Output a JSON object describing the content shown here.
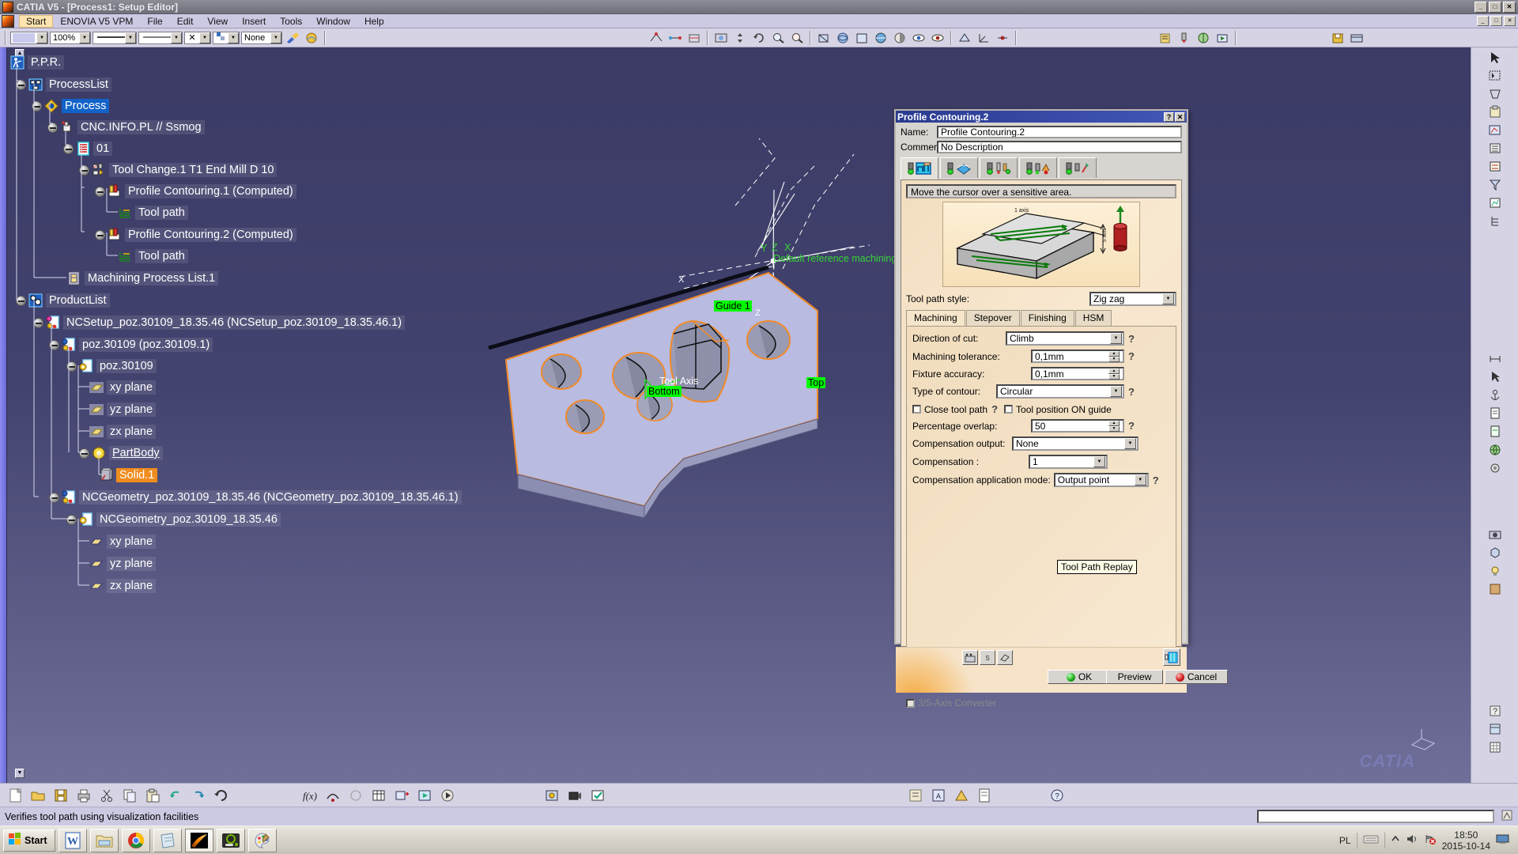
{
  "window": {
    "title": "CATIA V5 - [Process1: Setup Editor]",
    "buttons": [
      "_",
      "□",
      "✕"
    ],
    "doc_buttons": [
      "_",
      "□",
      "✕"
    ]
  },
  "menubar": {
    "items": [
      "Start",
      "ENOVIA V5 VPM",
      "File",
      "Edit",
      "View",
      "Insert",
      "Tools",
      "Window",
      "Help"
    ],
    "active": "Start"
  },
  "toolbar": {
    "zoom_value": "100%",
    "none_value": "None",
    "line_value": "",
    "weight_value": "",
    "x_value": "",
    "layer_value": ""
  },
  "tree": {
    "items": [
      {
        "label": "P.P.R.",
        "indent": 0,
        "icon": "ppr-icon",
        "state": "normal"
      },
      {
        "label": "ProcessList",
        "indent": 1,
        "icon": "processlist-icon",
        "state": "normal"
      },
      {
        "label": "Process",
        "indent": 2,
        "icon": "process-icon",
        "state": "selected"
      },
      {
        "label": "CNC.INFO.PL  // Ssmog",
        "indent": 3,
        "icon": "machine-icon",
        "state": "normal"
      },
      {
        "label": "01",
        "indent": 4,
        "icon": "program-icon",
        "state": "normal"
      },
      {
        "label": "Tool Change.1  T1 End Mill D 10",
        "indent": 5,
        "icon": "toolchange-icon",
        "state": "normal"
      },
      {
        "label": "Profile Contouring.1 (Computed)",
        "indent": 5,
        "icon": "contouring-icon",
        "state": "normal"
      },
      {
        "label": "Tool path",
        "indent": 6,
        "icon": "toolpath-icon",
        "state": "normal"
      },
      {
        "label": "Profile Contouring.2 (Computed)",
        "indent": 5,
        "icon": "contouring-icon",
        "state": "normal"
      },
      {
        "label": "Tool path",
        "indent": 6,
        "icon": "toolpath-icon",
        "state": "normal"
      },
      {
        "label": "Machining Process List.1",
        "indent": 4,
        "icon": "machproclist-icon",
        "state": "normal"
      },
      {
        "label": "ProductList",
        "indent": 1,
        "icon": "productlist-icon",
        "state": "normal"
      },
      {
        "label": "NCSetup_poz.30109_18.35.46 (NCSetup_poz.30109_18.35.46.1)",
        "indent": 2,
        "icon": "ncsetup-icon",
        "state": "normal"
      },
      {
        "label": "poz.30109 (poz.30109.1)",
        "indent": 3,
        "icon": "part-icon",
        "state": "normal"
      },
      {
        "label": "poz.30109",
        "indent": 4,
        "icon": "partdoc-icon",
        "state": "normal"
      },
      {
        "label": "xy plane",
        "indent": 5,
        "icon": "plane-icon",
        "state": "normal"
      },
      {
        "label": "yz plane",
        "indent": 5,
        "icon": "plane-icon",
        "state": "normal"
      },
      {
        "label": "zx plane",
        "indent": 5,
        "icon": "plane-icon",
        "state": "normal"
      },
      {
        "label": "PartBody",
        "indent": 5,
        "icon": "partbody-icon",
        "state": "underline"
      },
      {
        "label": "Solid.1",
        "indent": 6,
        "icon": "solid-icon",
        "state": "orange"
      },
      {
        "label": "NCGeometry_poz.30109_18.35.46 (NCGeometry_poz.30109_18.35.46.1)",
        "indent": 3,
        "icon": "ncsetup-icon",
        "state": "normal"
      },
      {
        "label": "NCGeometry_poz.30109_18.35.46",
        "indent": 4,
        "icon": "partdoc-icon",
        "state": "normal"
      },
      {
        "label": "xy plane",
        "indent": 5,
        "icon": "plane2-icon",
        "state": "normal"
      },
      {
        "label": "yz plane",
        "indent": 5,
        "icon": "plane2-icon",
        "state": "normal"
      },
      {
        "label": "zx plane",
        "indent": 5,
        "icon": "plane2-icon",
        "state": "normal"
      }
    ]
  },
  "viewport": {
    "labels": {
      "guide1": "Guide 1",
      "top": "Top",
      "bottom": "Bottom",
      "tool_axis": "Tool Axis",
      "default_ref": "Default reference machining axis",
      "axis_x": "X",
      "axis_y": "Y",
      "axis_z": "Z",
      "axis_x2": "X",
      "axis_z2": "Z"
    },
    "catia_watermark": "CATIA"
  },
  "dialog": {
    "title": "Profile Contouring.2",
    "help_btn": "?",
    "close_btn": "✕",
    "name_label": "Name:",
    "name_value": "Profile Contouring.2",
    "comment_label": "Comment:",
    "comment_value": "No Description",
    "big_tabs": [
      {
        "name": "geometry-tab",
        "icon": "geometry-icon",
        "active": true
      },
      {
        "name": "strategy-tab",
        "icon": "strategy-icon",
        "active": false
      },
      {
        "name": "tool-tab",
        "icon": "tool-icon",
        "active": false
      },
      {
        "name": "feeds-speeds-tab",
        "icon": "feeds-icon",
        "active": false
      },
      {
        "name": "macros-tab",
        "icon": "macros-icon",
        "active": false
      }
    ],
    "sensitive_text": "Move the cursor over a sensitive area.",
    "tool_path_style_label": "Tool path style:",
    "tool_path_style_value": "Zig zag",
    "sub_tabs": [
      "Machining",
      "Stepover",
      "Finishing",
      "HSM"
    ],
    "sub_tab_active": "Machining",
    "params": {
      "direction_of_cut_label": "Direction of cut:",
      "direction_of_cut_value": "Climb",
      "machining_tolerance_label": "Machining tolerance:",
      "machining_tolerance_value": "0,1mm",
      "fixture_accuracy_label": "Fixture accuracy:",
      "fixture_accuracy_value": "0,1mm",
      "type_of_contour_label": "Type of contour:",
      "type_of_contour_value": "Circular",
      "close_tool_path_label": "Close tool path",
      "tool_position_on_guide_label": "Tool position ON guide",
      "percentage_overlap_label": "Percentage overlap:",
      "percentage_overlap_value": "50",
      "compensation_output_label": "Compensation output:",
      "compensation_output_value": "None",
      "compensation_label": "Compensation  :",
      "compensation_value": "1",
      "compensation_app_mode_label": "Compensation application mode:",
      "compensation_app_mode_value": "Output point",
      "converter_label": "3/5-Axis Converter"
    },
    "footer": {
      "ok_label": "OK",
      "preview_label": "Preview",
      "cancel_label": "Cancel",
      "tooltip": "Tool Path Replay"
    }
  },
  "statusbar": {
    "message": "Verifies tool path using visualization facilities"
  },
  "taskbar": {
    "start_label": "Start",
    "apps": [
      {
        "name": "word-taskbar-icon",
        "glyph": "W"
      },
      {
        "name": "explorer-taskbar-icon",
        "glyph": "📁"
      },
      {
        "name": "chrome-taskbar-icon",
        "glyph": "◉"
      },
      {
        "name": "notepad-taskbar-icon",
        "glyph": "📄"
      },
      {
        "name": "catia-taskbar-icon",
        "glyph": "▰"
      },
      {
        "name": "nvidia-taskbar-icon",
        "glyph": "◎"
      },
      {
        "name": "paint-taskbar-icon",
        "glyph": "🎨"
      }
    ],
    "tray": {
      "language": "PL",
      "time": "18:50",
      "date": "2015-10-14"
    }
  }
}
